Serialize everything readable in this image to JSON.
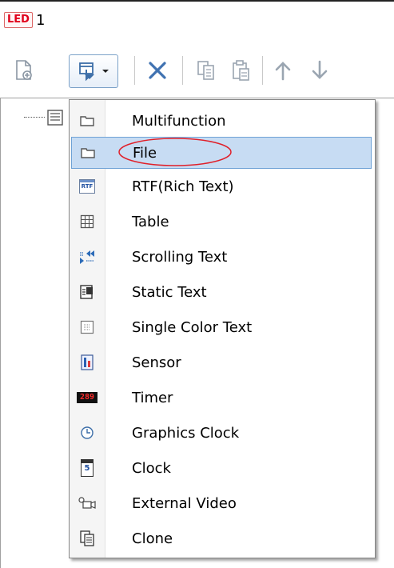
{
  "tab": {
    "badge": "LED",
    "number": "1"
  },
  "menu": {
    "items": [
      {
        "label": "Multifunction",
        "icon": "folder-icon"
      },
      {
        "label": "File",
        "icon": "folder-icon"
      },
      {
        "label": "RTF(Rich Text)",
        "icon": "rtf-icon"
      },
      {
        "label": "Table",
        "icon": "table-icon"
      },
      {
        "label": "Scrolling Text",
        "icon": "scrolling-text-icon"
      },
      {
        "label": "Static Text",
        "icon": "static-text-icon"
      },
      {
        "label": "Single Color Text",
        "icon": "single-color-text-icon"
      },
      {
        "label": "Sensor",
        "icon": "sensor-icon"
      },
      {
        "label": "Timer",
        "icon": "timer-icon"
      },
      {
        "label": "Graphics Clock",
        "icon": "graphics-clock-icon"
      },
      {
        "label": "Clock",
        "icon": "clock-icon"
      },
      {
        "label": "External Video",
        "icon": "external-video-icon"
      },
      {
        "label": "Clone",
        "icon": "clone-icon"
      }
    ],
    "hovered_item": "File",
    "rtf_icon_text": "RTF",
    "timer_icon_text": "289",
    "clock_icon_text": "5"
  },
  "colors": {
    "hover_bg": "#c7dcf3",
    "hover_border": "#6fa2d6",
    "annotation": "#e0202a",
    "toolbar_icon": "#9aa5b1"
  }
}
